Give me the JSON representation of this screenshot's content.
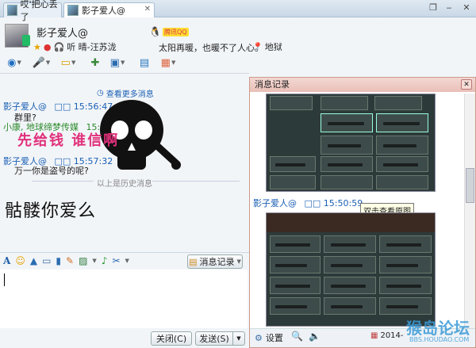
{
  "tabs": [
    {
      "label": "哎'把心丢了"
    },
    {
      "label": "影子爱人@"
    }
  ],
  "window_controls": {
    "restore": "❐",
    "minimize": "‒",
    "close": "✕"
  },
  "header": {
    "nickname": "影子爱人@",
    "level_badge": "腾讯QQ",
    "listening_label": "听 晴-汪苏泷",
    "status_text": "太阳再暖，也暖不了人心。",
    "location": "地狱"
  },
  "chat": {
    "more_link": "查看更多消息",
    "messages": [
      {
        "sender": "影子爱人@",
        "meta": "□□ 15:56:47",
        "text": "群里?"
      },
      {
        "sender": "小康, 地球缔梦传媒",
        "meta": "15:57:01",
        "text": ""
      },
      {
        "sender": "影子爱人@",
        "meta": "□□ 15:57:32",
        "text": "万一你是盗号的呢?"
      }
    ],
    "sticker_text": "先给钱 谁信啊",
    "divider_text": "以上是历史消息",
    "handwriting_text": "骷髅你爱么"
  },
  "input_toolbar": {
    "history_button": "消息记录"
  },
  "footer": {
    "close_button": "关闭(C)",
    "send_button": "发送(S)"
  },
  "history_popup": {
    "title": "消息记录",
    "sender": "影子爱人@",
    "meta": "□□ 15:50:59",
    "tooltip": "双击查看原图",
    "settings_label": "设置",
    "date_label": "2014-"
  },
  "watermark": {
    "brand": "猴岛论坛",
    "url": "BBS.HOUDAO.COM"
  },
  "colors": {
    "link": "#1a5fb4",
    "sticker_pink": "#e0307a",
    "popup_title_bg": "#ebc6bf"
  }
}
